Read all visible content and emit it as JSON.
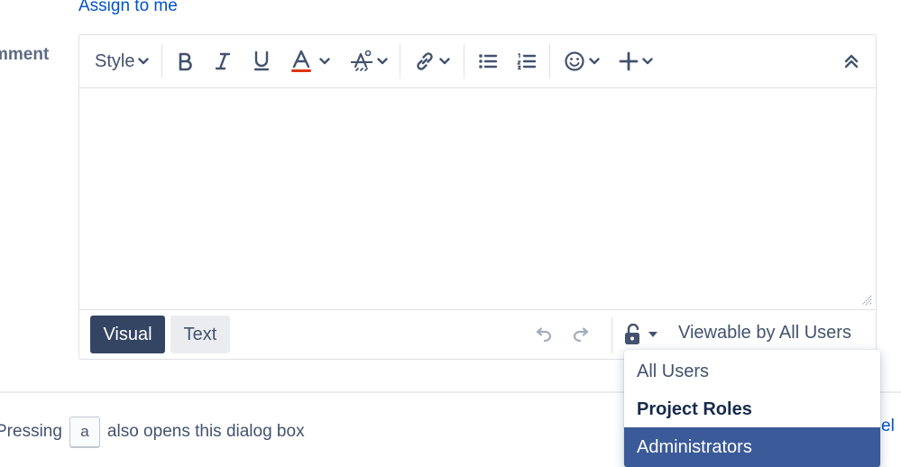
{
  "assign_link": "Assign to me",
  "field_label": "mment",
  "toolbar": {
    "style_label": "Style",
    "buttons": [
      "bold-icon",
      "italic-icon",
      "underline-icon",
      "text-color-icon",
      "clear-format-icon",
      "link-icon",
      "bullet-list-icon",
      "numbered-list-icon",
      "emoji-icon",
      "insert-more-icon",
      "collapse-toolbar-icon"
    ],
    "text_color_accent": "#de350b"
  },
  "footer": {
    "visual_label": "Visual",
    "text_label": "Text",
    "visibility_text": "Viewable by All Users"
  },
  "hint": {
    "before": "Pressing",
    "key": "a",
    "after": "also opens this dialog box"
  },
  "cancel_fragment": "el",
  "dropdown": {
    "all_users": "All Users",
    "group_heading": "Project Roles",
    "selected_item": "Administrators",
    "selected_color": "#3b5a99"
  }
}
